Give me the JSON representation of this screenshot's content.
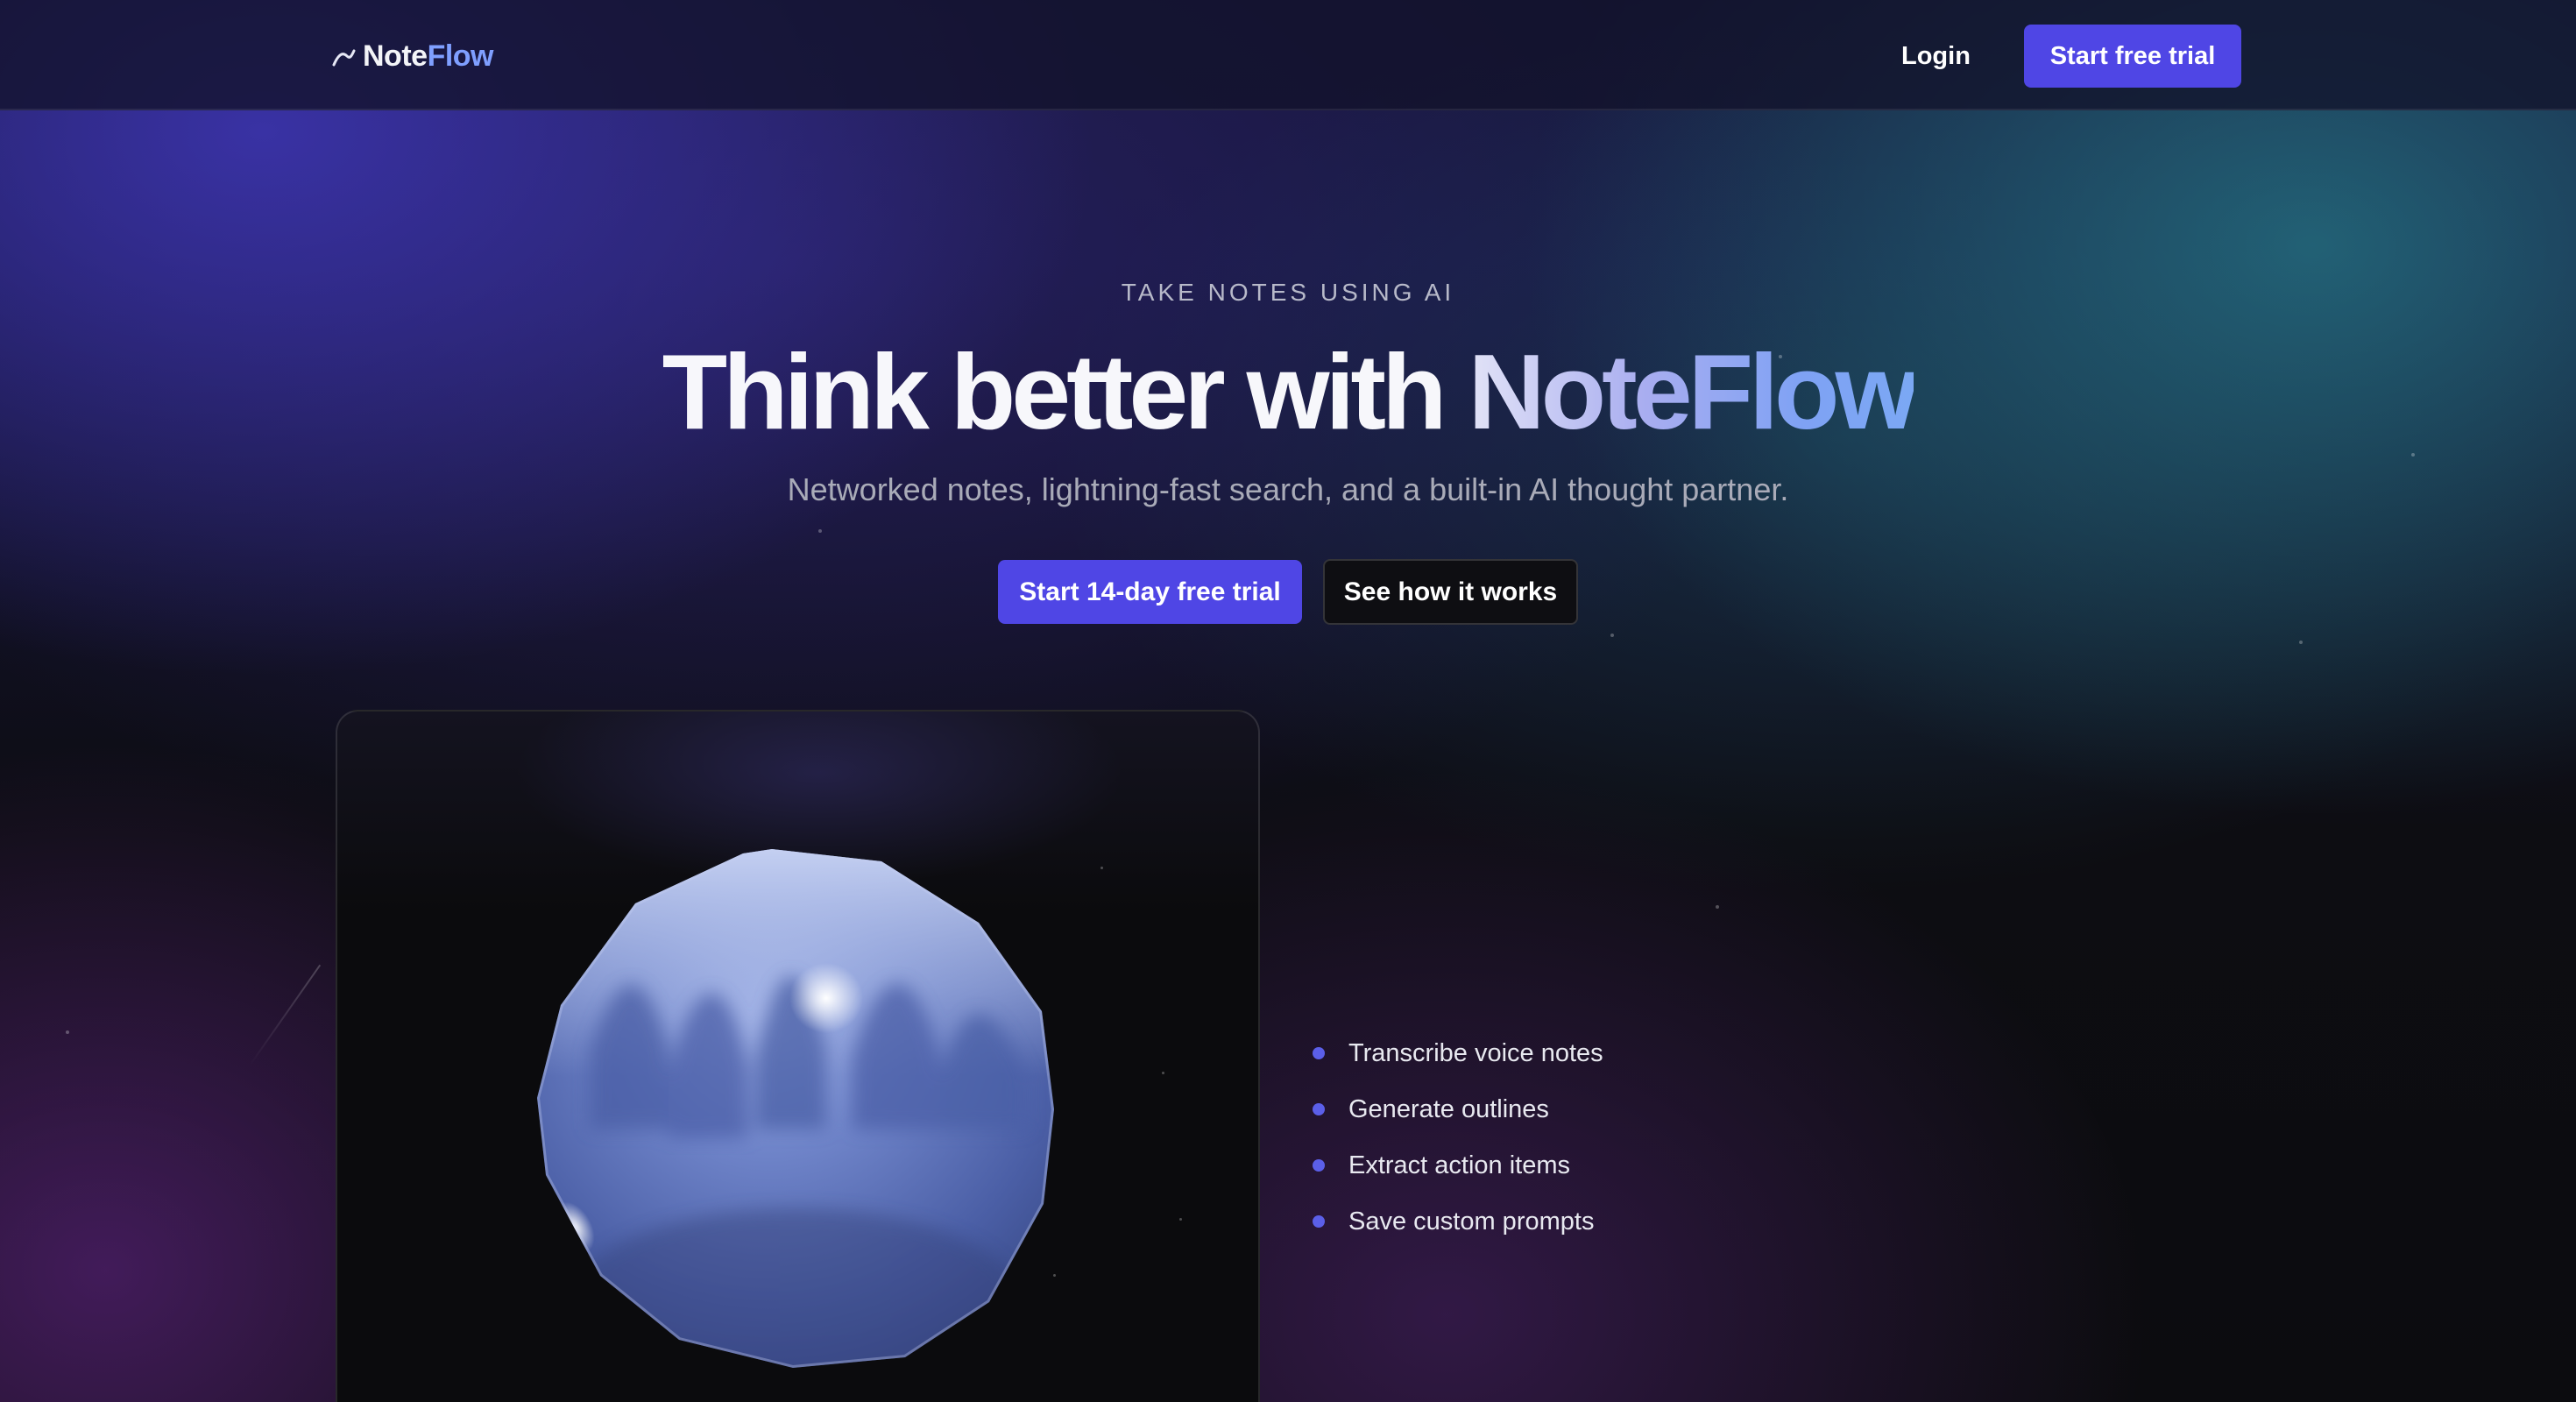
{
  "nav": {
    "logo_part1": "Note",
    "logo_part2": "Flow",
    "login_label": "Login",
    "cta_label": "Start free trial"
  },
  "hero": {
    "eyebrow": "TAKE NOTES USING AI",
    "headline_main": "Think better with ",
    "headline_brand": "NoteFlow",
    "subhead": "Networked notes, lightning-fast search, and a built-in AI thought partner.",
    "primary_cta": "Start 14-day free trial",
    "secondary_cta": "See how it works"
  },
  "features": [
    "Transcribe voice notes",
    "Generate outlines",
    "Extract action items",
    "Save custom prompts"
  ],
  "colors": {
    "accent": "#4f46e5",
    "brand_gradient_end": "#7fa2f4",
    "background": "#0c0c0f",
    "bullet": "#5b5fe8"
  },
  "icons": {
    "logo": "flow-curve-icon",
    "bullets": "dot-bullet"
  }
}
